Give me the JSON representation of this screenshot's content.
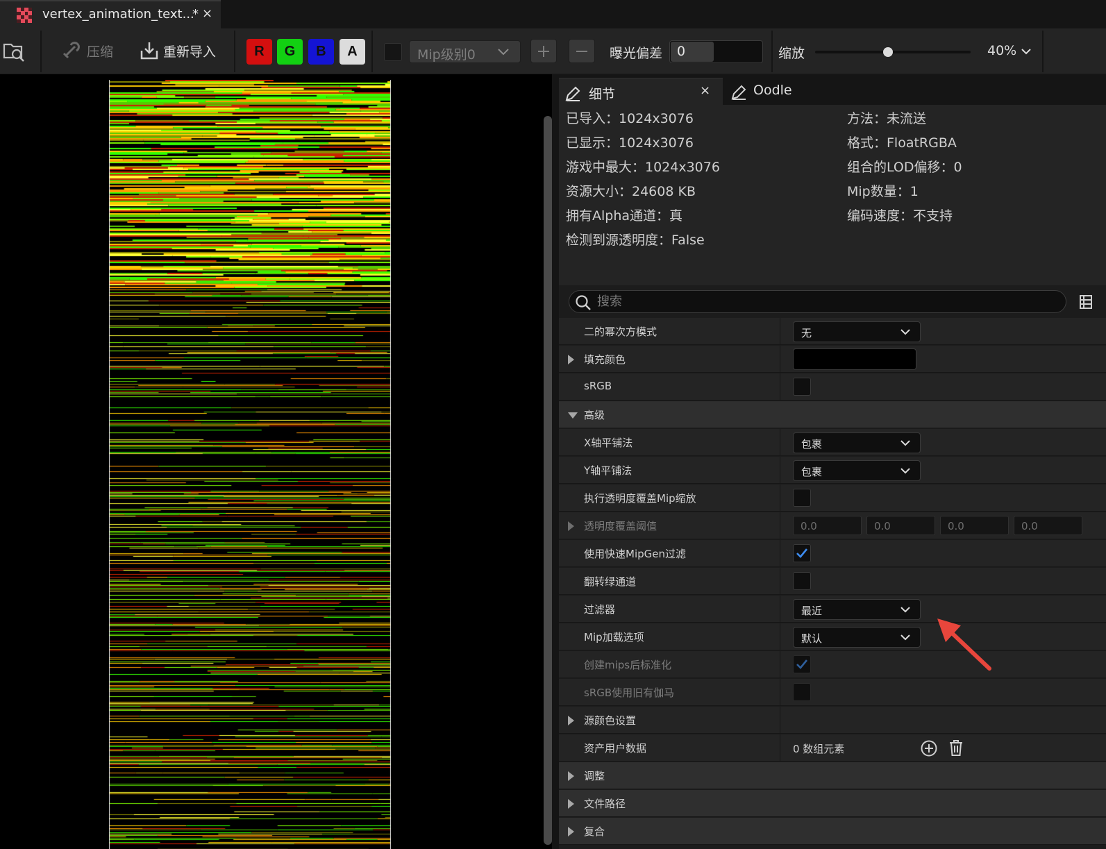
{
  "tab": {
    "title": "vertex_animation_text...",
    "modified": "*",
    "close": "×"
  },
  "toolbar": {
    "compress_label": "压缩",
    "reimport_label": "重新导入",
    "channels": [
      {
        "label": "R",
        "color": "#d40f0f"
      },
      {
        "label": "G",
        "color": "#12d012"
      },
      {
        "label": "B",
        "color": "#1414d4"
      },
      {
        "label": "A",
        "color": "#dcdcdc"
      }
    ],
    "mip_dropdown": "Mip级别0",
    "exposure_label": "曝光偏差",
    "exposure_value": "0",
    "zoom_label": "缩放",
    "zoom_value": "40%",
    "zoom_slider_fraction": 0.47
  },
  "details": {
    "tab_details": "细节",
    "tab_close": "×",
    "tab_oodle": "Oodle",
    "info_left": [
      "已导入：1024x3076",
      "已显示：1024x3076",
      "游戏中最大：1024x3076",
      "资源大小：24608 KB",
      "拥有Alpha通道：真",
      "检测到源透明度：False"
    ],
    "info_right": [
      "方法：未流送",
      "格式：FloatRGBA",
      "组合的LOD偏移：0",
      "Mip数量：1",
      "编码速度：不支持"
    ],
    "search_placeholder": "搜索",
    "rows": {
      "pow2": {
        "label": "二的幂次方模式",
        "value": "无"
      },
      "fill": {
        "label": "填充颜色",
        "value_color": "#000000"
      },
      "srgb": {
        "label": "sRGB",
        "checked": false
      },
      "advanced": {
        "label": "高级"
      },
      "xtile": {
        "label": "X轴平铺法",
        "value": "包裹"
      },
      "ytile": {
        "label": "Y轴平铺法",
        "value": "包裹"
      },
      "alpha_cov": {
        "label": "执行透明度覆盖Mip缩放",
        "checked": false
      },
      "alpha_thr": {
        "label": "透明度覆盖阈值",
        "values": [
          "0.0",
          "0.0",
          "0.0",
          "0.0"
        ]
      },
      "fastmip": {
        "label": "使用快速MipGen过滤",
        "checked": true
      },
      "flipgreen": {
        "label": "翻转绿通道",
        "checked": false
      },
      "filter": {
        "label": "过滤器",
        "value": "最近"
      },
      "mipload": {
        "label": "Mip加载选项",
        "value": "默认"
      },
      "normalize": {
        "label": "创建mips后标准化",
        "checked": true
      },
      "legacygamma": {
        "label": "sRGB使用旧有伽马",
        "checked": false
      },
      "srccolor": {
        "label": "源颜色设置"
      },
      "userdata": {
        "label": "资产用户数据",
        "value": "0 数组元素"
      },
      "adjust": {
        "label": "调整"
      },
      "filepath": {
        "label": "文件路径"
      },
      "composite": {
        "label": "复合"
      }
    },
    "annotation_arrow_color": "#e8463c"
  }
}
